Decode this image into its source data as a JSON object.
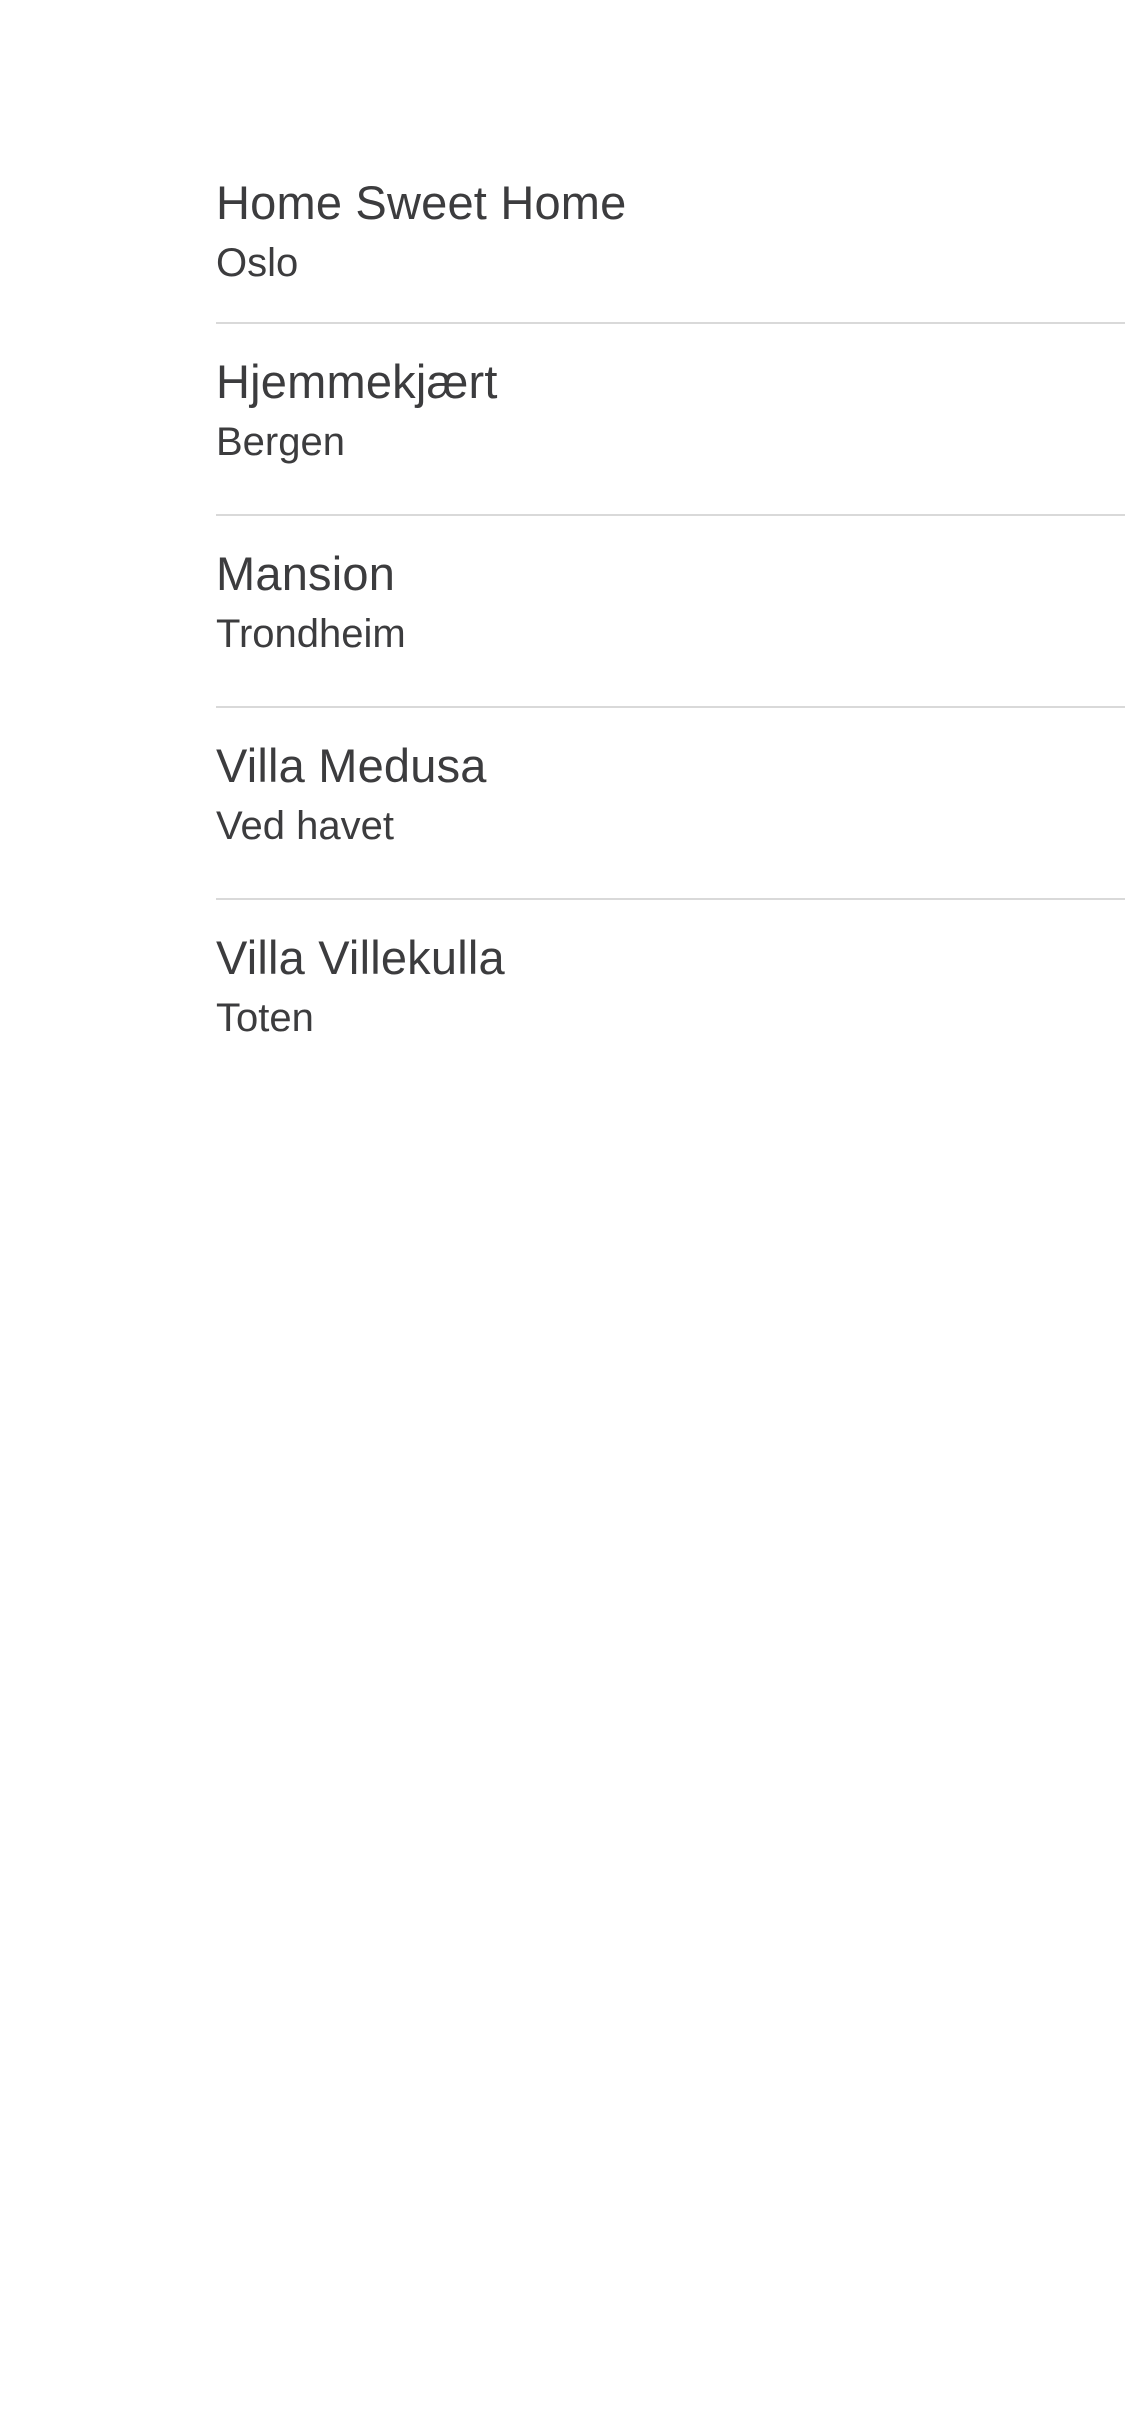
{
  "homes": {
    "items": [
      {
        "name": "Home Sweet Home",
        "location": "Oslo"
      },
      {
        "name": "Hjemmekjært",
        "location": "Bergen"
      },
      {
        "name": "Mansion",
        "location": "Trondheim"
      },
      {
        "name": "Villa Medusa",
        "location": "Ved havet"
      },
      {
        "name": "Villa Villekulla",
        "location": "Toten"
      }
    ]
  },
  "colors": {
    "background": "#ffffff",
    "text": "#3c3c3e",
    "divider": "#d9d9d9"
  }
}
